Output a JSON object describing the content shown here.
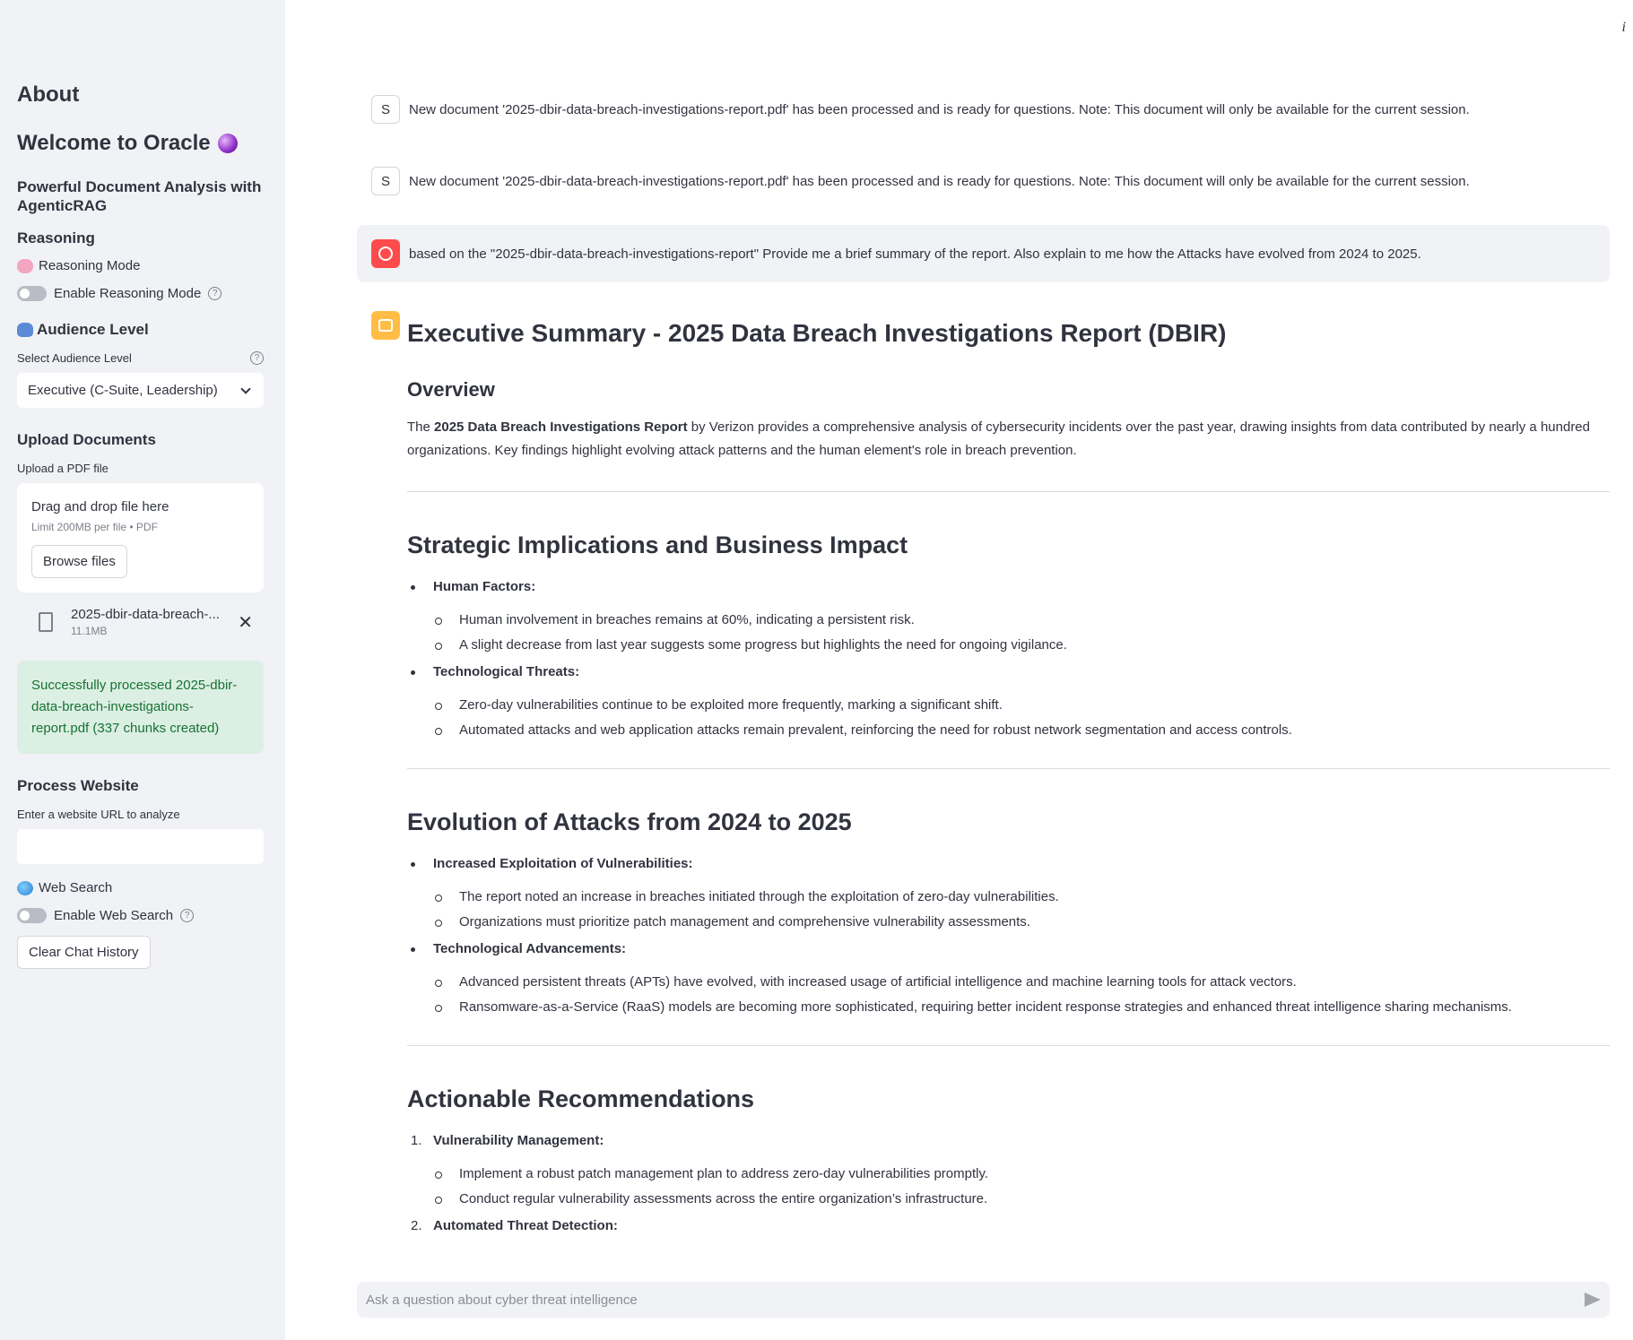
{
  "sidebar": {
    "about": "About",
    "welcome": "Welcome to Oracle",
    "subtitle": "Powerful Document Analysis with AgenticRAG",
    "reasoning_heading": "Reasoning",
    "reasoning_mode_label": "Reasoning Mode",
    "enable_reasoning_label": "Enable Reasoning Mode",
    "audience_heading": "Audience Level",
    "select_audience_label": "Select Audience Level",
    "audience_value": "Executive (C-Suite, Leadership)",
    "upload_heading": "Upload Documents",
    "upload_label": "Upload a PDF file",
    "drag_drop": "Drag and drop file here",
    "limit": "Limit 200MB per file • PDF",
    "browse": "Browse files",
    "file_name": "2025-dbir-data-breach-...",
    "file_size": "11.1MB",
    "success": "Successfully processed 2025-dbir-data-breach-investigations-report.pdf (337 chunks created)",
    "website_heading": "Process Website",
    "url_label": "Enter a website URL to analyze",
    "url_value": "",
    "web_search_label": "Web Search",
    "enable_web_search_label": "Enable Web Search",
    "clear_chat": "Clear Chat History"
  },
  "main": {
    "info_icon": "i",
    "system_avatar": "S",
    "system_msg_1": "New document '2025-dbir-data-breach-investigations-report.pdf' has been processed and is ready for questions. Note: This document will only be available for the current session.",
    "system_msg_2": "New document '2025-dbir-data-breach-investigations-report.pdf' has been processed and is ready for questions. Note: This document will only be available for the current session.",
    "user_msg": "based on the \"2025-dbir-data-breach-investigations-report\" Provide me a brief summary of the report. Also explain to me how the Attacks have evolved from 2024 to 2025.",
    "response": {
      "title": "Executive Summary - 2025 Data Breach Investigations Report (DBIR)",
      "overview_heading": "Overview",
      "overview_pre": "The ",
      "overview_bold": "2025 Data Breach Investigations Report",
      "overview_post": " by Verizon provides a comprehensive analysis of cybersecurity incidents over the past year, drawing insights from data contributed by nearly a hundred organizations. Key findings highlight evolving attack patterns and the human element's role in breach prevention.",
      "strategic_heading": "Strategic Implications and Business Impact",
      "strategic_items": [
        {
          "label": "Human Factors:",
          "subs": [
            "Human involvement in breaches remains at 60%, indicating a persistent risk.",
            "A slight decrease from last year suggests some progress but highlights the need for ongoing vigilance."
          ]
        },
        {
          "label": "Technological Threats:",
          "subs": [
            "Zero-day vulnerabilities continue to be exploited more frequently, marking a significant shift.",
            "Automated attacks and web application attacks remain prevalent, reinforcing the need for robust network segmentation and access controls."
          ]
        }
      ],
      "evolution_heading": "Evolution of Attacks from 2024 to 2025",
      "evolution_items": [
        {
          "label": "Increased Exploitation of Vulnerabilities:",
          "subs": [
            "The report noted an increase in breaches initiated through the exploitation of zero-day vulnerabilities.",
            "Organizations must prioritize patch management and comprehensive vulnerability assessments."
          ]
        },
        {
          "label": "Technological Advancements:",
          "subs": [
            "Advanced persistent threats (APTs) have evolved, with increased usage of artificial intelligence and machine learning tools for attack vectors.",
            "Ransomware-as-a-Service (RaaS) models are becoming more sophisticated, requiring better incident response strategies and enhanced threat intelligence sharing mechanisms."
          ]
        }
      ],
      "recommendations_heading": "Actionable Recommendations",
      "recommendation_items": [
        {
          "num": "1.",
          "label": "Vulnerability Management:",
          "subs": [
            "Implement a robust patch management plan to address zero-day vulnerabilities promptly.",
            "Conduct regular vulnerability assessments across the entire organization’s infrastructure."
          ]
        },
        {
          "num": "2.",
          "label": "Automated Threat Detection:",
          "subs": []
        }
      ]
    },
    "chat_placeholder": "Ask a question about cyber threat intelligence"
  }
}
